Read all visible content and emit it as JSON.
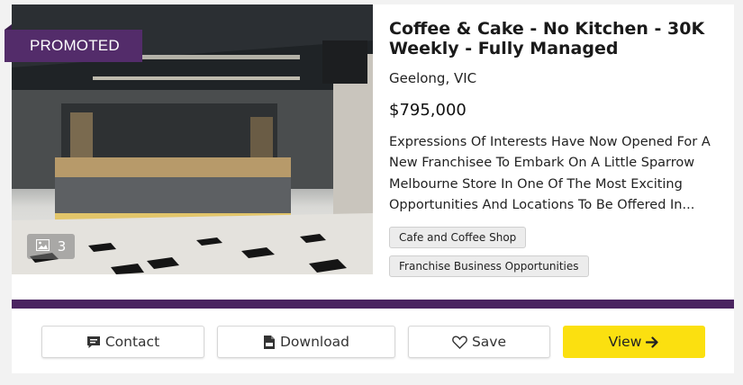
{
  "listing": {
    "promo_label": "PROMOTED",
    "photo_count": "3",
    "title": "Coffee & Cake - No Kitchen - 30K Weekly - Fully Managed",
    "location": "Geelong, VIC",
    "price": "$795,000",
    "description": "Expressions Of Interests Have Now Opened For A New Franchisee To Embark On A Little Sparrow Melbourne Store In One Of The Most Exciting Opportunities And Locations To Be Offered In...",
    "tags": [
      "Cafe and Coffee Shop",
      "Franchise Business Opportunities"
    ]
  },
  "actions": {
    "contact": "Contact",
    "download": "Download",
    "save": "Save",
    "view": "View"
  },
  "icons": {
    "gallery": "image-icon",
    "contact": "comment-icon",
    "download": "pdf-file-icon",
    "save": "heart-outline-icon",
    "view": "arrow-right-icon"
  },
  "colors": {
    "promo": "#532c6a",
    "divider": "#4a2460",
    "view_button": "#fbe010"
  }
}
